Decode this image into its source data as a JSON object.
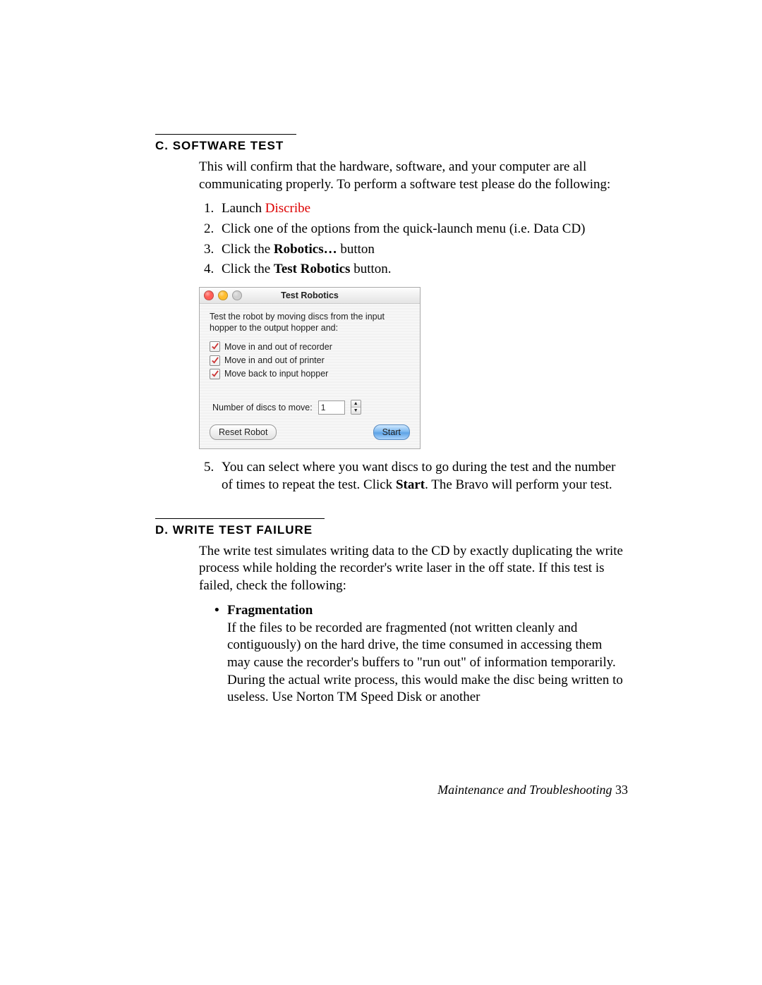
{
  "sectionC": {
    "heading": "C. SOFTWARE TEST",
    "intro": "This will confirm that the hardware, software, and your computer are all communicating properly. To perform a software test please do the following:",
    "steps": {
      "s1_a": "Launch ",
      "s1_b": "Discribe",
      "s2": "Click one of the options from the quick-launch menu (i.e. Data CD)",
      "s3_a": "Click the ",
      "s3_b": "Robotics…",
      "s3_c": " button",
      "s4_a": "Click the ",
      "s4_b": "Test Robotics",
      "s4_c": " button.",
      "s5_a": "You can select where you want discs to go during the test and the number of times to repeat the test. Click ",
      "s5_b": "Start",
      "s5_c": ". The Bravo will perform your test."
    }
  },
  "dialog": {
    "title": "Test Robotics",
    "instruction": "Test the robot by moving discs from the input hopper to the output hopper and:",
    "chk1": "Move in and out of recorder",
    "chk2": "Move in and out of printer",
    "chk3": "Move back to input hopper",
    "numLabel": "Number of discs to move:",
    "numValue": "1",
    "resetBtn": "Reset Robot",
    "startBtn": "Start"
  },
  "sectionD": {
    "heading": "D. WRITE TEST FAILURE",
    "intro": "The write test simulates writing data to the CD by exactly duplicating the write process while holding the recorder's write laser in the off state. If this test is failed, check the following:",
    "bullet_title": "Fragmentation",
    "bullet_body": "If the files to be recorded are fragmented (not written cleanly and contiguously) on the hard drive, the time consumed in accessing them may cause the recorder's buffers to \"run out\" of information temporarily. During the actual write process, this would make the disc being written to useless. Use Norton TM Speed Disk or another"
  },
  "footer": {
    "text": "Maintenance and Troubleshooting ",
    "page": "33"
  }
}
